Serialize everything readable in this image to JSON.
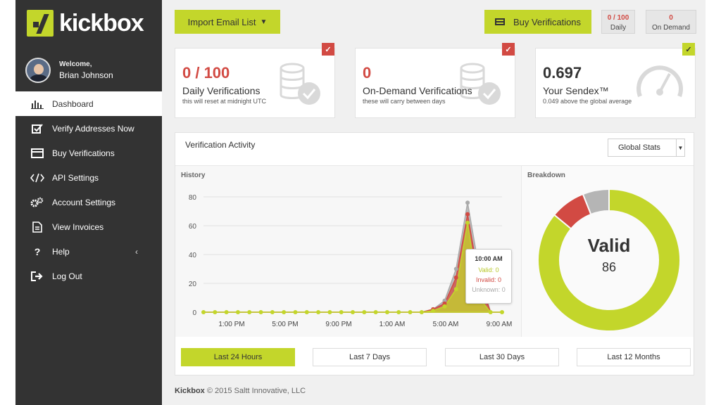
{
  "brand": {
    "name": "kickbox",
    "accent": "#c3d62b",
    "danger": "#d24a43"
  },
  "user": {
    "welcome": "Welcome,",
    "name": "Brian Johnson"
  },
  "sidebar": {
    "items": [
      {
        "label": "Dashboard",
        "icon": "bar-chart-icon",
        "active": true
      },
      {
        "label": "Verify Addresses Now",
        "icon": "checkbox-icon"
      },
      {
        "label": "Buy Verifications",
        "icon": "credit-card-icon"
      },
      {
        "label": "API Settings",
        "icon": "code-icon"
      },
      {
        "label": "Account Settings",
        "icon": "gears-icon"
      },
      {
        "label": "View Invoices",
        "icon": "document-icon"
      },
      {
        "label": "Help",
        "icon": "question-icon"
      },
      {
        "label": "Log Out",
        "icon": "logout-icon"
      }
    ]
  },
  "toolbar": {
    "import_label": "Import Email List",
    "buy_label": "Buy Verifications",
    "daily_count": "0 / 100",
    "daily_label": "Daily",
    "ondemand_count": "0",
    "ondemand_label": "On Demand"
  },
  "stats": [
    {
      "value": "0 / 100",
      "label": "Daily Verifications",
      "sub": "this will reset at midnight UTC",
      "icon": "coins-icon"
    },
    {
      "value": "0",
      "label": "On-Demand Verifications",
      "sub": "these will carry between days",
      "icon": "coins-icon"
    },
    {
      "value": "0.697",
      "label": "Your Sendex™",
      "sub": "0.049 above the global average",
      "icon": "gauge-icon"
    }
  ],
  "activity": {
    "title": "Verification Activity",
    "select_value": "Global Stats",
    "history_label": "History",
    "breakdown_label": "Breakdown",
    "tooltip": {
      "time": "10:00 AM",
      "valid": "Valid: 0",
      "invalid": "Invalid: 0",
      "unknown": "Unknown: 0"
    },
    "donut_title": "Valid",
    "donut_value": "86"
  },
  "chart_data": {
    "type": "area",
    "x_tick_labels": [
      "1:00 PM",
      "5:00 PM",
      "9:00 PM",
      "1:00 AM",
      "5:00 AM",
      "9:00 AM"
    ],
    "y_ticks": [
      0,
      20,
      40,
      60,
      80
    ],
    "ylim": [
      0,
      80
    ],
    "series": [
      {
        "name": "Unknown",
        "color": "#aaaaaa",
        "values": [
          0,
          0,
          0,
          0,
          0,
          0,
          0,
          0,
          0,
          0,
          0,
          0,
          0,
          0,
          0,
          0,
          0,
          0,
          0,
          0,
          2,
          8,
          30,
          76,
          30,
          0,
          0
        ]
      },
      {
        "name": "Invalid",
        "color": "#d24a43",
        "values": [
          0,
          0,
          0,
          0,
          0,
          0,
          0,
          0,
          0,
          0,
          0,
          0,
          0,
          0,
          0,
          0,
          0,
          0,
          0,
          0,
          2,
          6,
          24,
          68,
          22,
          0,
          0
        ]
      },
      {
        "name": "Valid",
        "color": "#c3d62b",
        "values": [
          0,
          0,
          0,
          0,
          0,
          0,
          0,
          0,
          0,
          0,
          0,
          0,
          0,
          0,
          0,
          0,
          0,
          0,
          0,
          0,
          1,
          4,
          16,
          62,
          10,
          0,
          0
        ]
      }
    ],
    "breakdown": [
      {
        "name": "Valid",
        "value": 86,
        "color": "#c3d62b"
      },
      {
        "name": "Invalid",
        "value": 8,
        "color": "#d24a43"
      },
      {
        "name": "Unknown",
        "value": 6,
        "color": "#b5b5b5"
      }
    ]
  },
  "ranges": [
    {
      "label": "Last 24 Hours",
      "active": true
    },
    {
      "label": "Last 7 Days"
    },
    {
      "label": "Last 30 Days"
    },
    {
      "label": "Last 12 Months"
    }
  ],
  "footer": {
    "brand": "Kickbox",
    "text": "© 2015 Saltt Innovative, LLC"
  }
}
